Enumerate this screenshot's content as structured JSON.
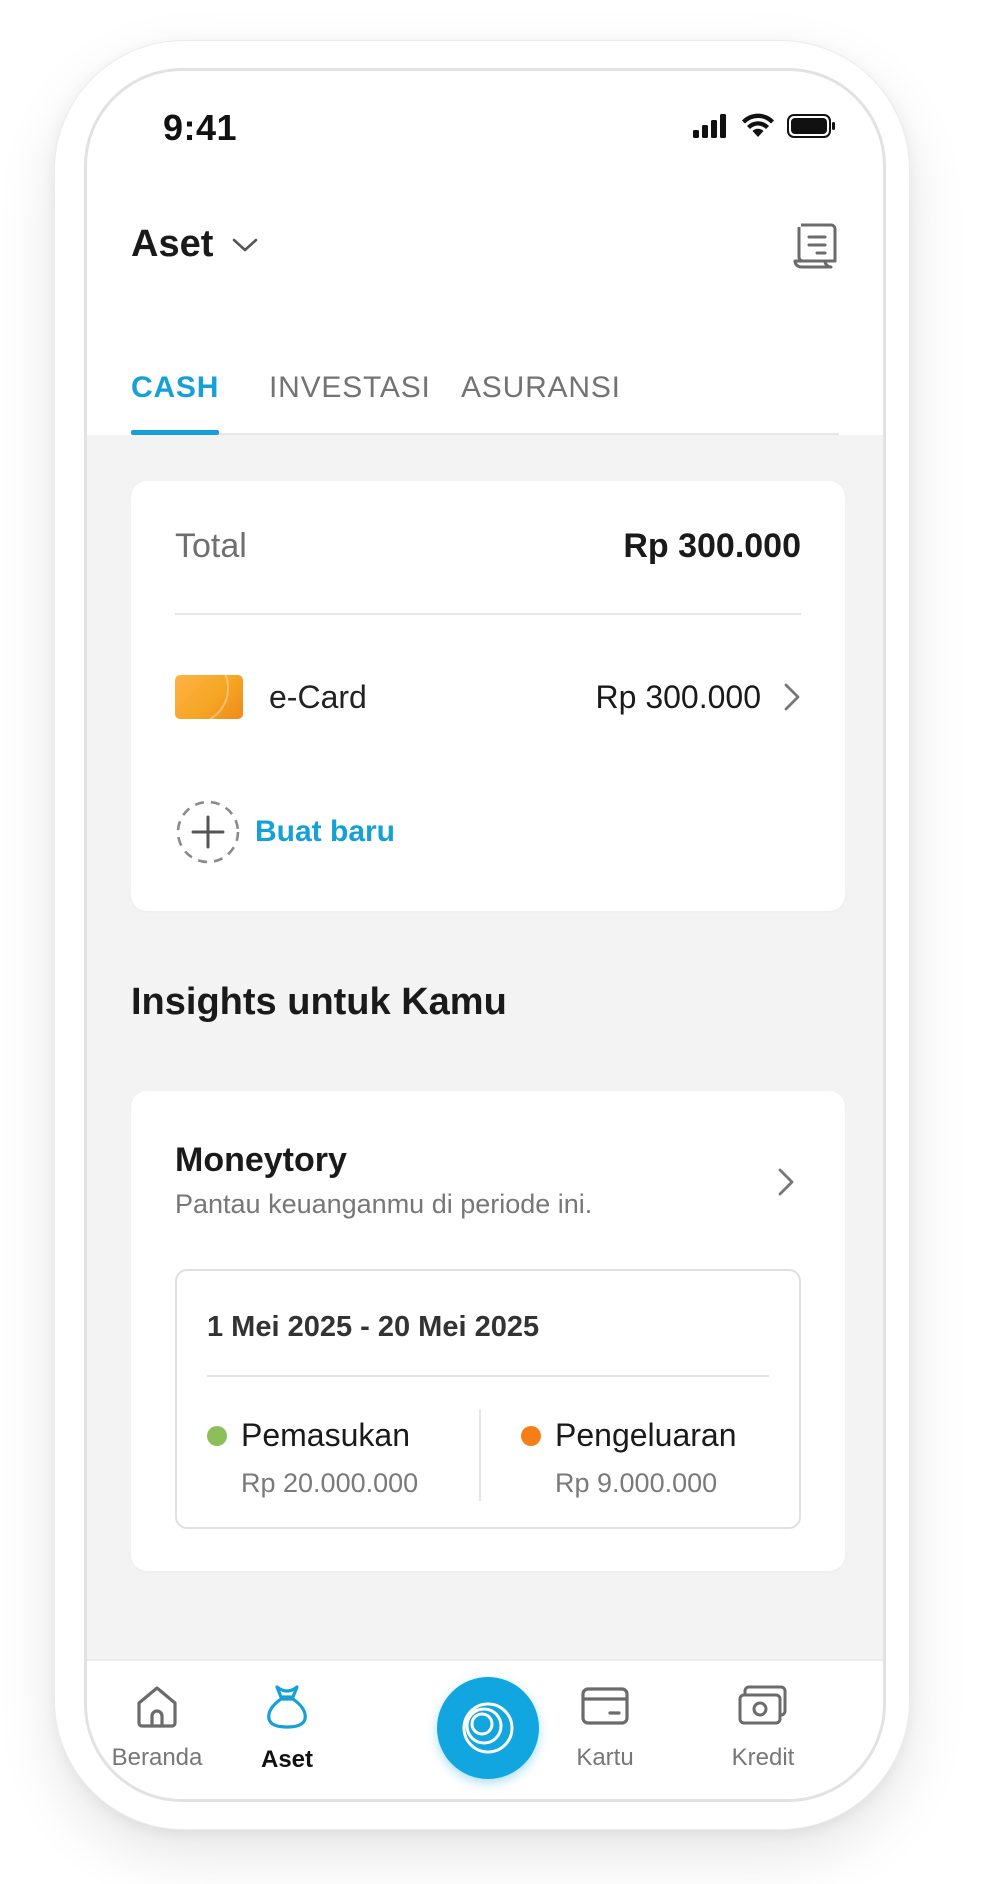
{
  "status_bar": {
    "time": "9:41"
  },
  "header": {
    "title": "Aset"
  },
  "tabs": [
    {
      "label": "CASH",
      "active": true
    },
    {
      "label": "INVESTASI",
      "active": false
    },
    {
      "label": "ASURANSI",
      "active": false
    }
  ],
  "cash_card": {
    "total_label": "Total",
    "total_value": "Rp 300.000",
    "accounts": [
      {
        "label": "e-Card",
        "value": "Rp 300.000"
      }
    ],
    "new_label": "Buat baru"
  },
  "insights": {
    "title": "Insights untuk Kamu",
    "moneytory": {
      "title": "Moneytory",
      "subtitle": "Pantau keuanganmu di periode ini.",
      "period": "1 Mei 2025 - 20 Mei 2025",
      "income": {
        "label": "Pemasukan",
        "value": "Rp 20.000.000",
        "color": "#8cbf5a"
      },
      "expense": {
        "label": "Pengeluaran",
        "value": "Rp 9.000.000",
        "color": "#f57f17"
      }
    }
  },
  "bottom_nav": {
    "items": [
      {
        "label": "Beranda",
        "icon": "home-icon",
        "active": false
      },
      {
        "label": "Aset",
        "icon": "money-bag-icon",
        "active": true
      },
      {
        "label": "",
        "icon": "rings-icon",
        "active": false
      },
      {
        "label": "Kartu",
        "icon": "card-icon",
        "active": false
      },
      {
        "label": "Kredit",
        "icon": "cash-icon",
        "active": false
      }
    ]
  },
  "colors": {
    "accent": "#16a0d8",
    "center_button": "#12a6e0"
  }
}
